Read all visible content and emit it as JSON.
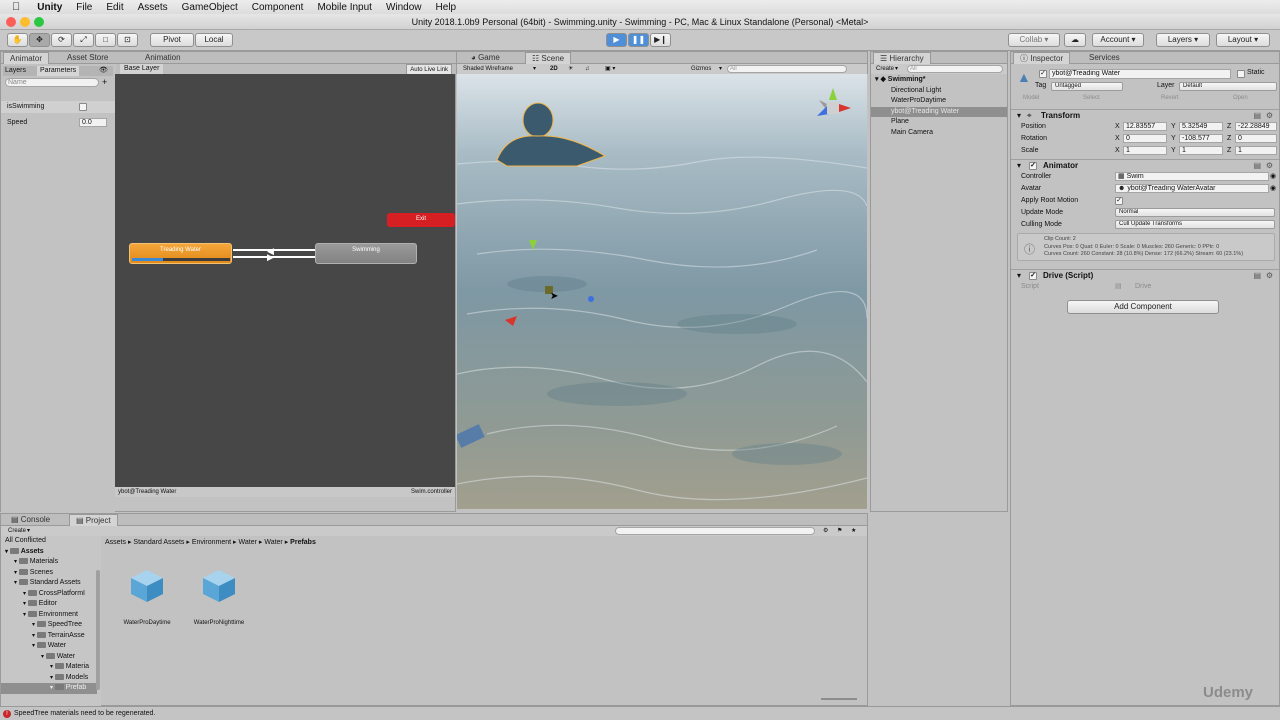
{
  "menubar": {
    "app": "Unity",
    "items": [
      "File",
      "Edit",
      "Assets",
      "GameObject",
      "Component",
      "Mobile Input",
      "Window",
      "Help"
    ]
  },
  "window_title": "Unity 2018.1.0b9 Personal (64bit) - Swimming.unity - Swimming - PC, Mac & Linux Standalone (Personal) <Metal>",
  "toolbar": {
    "pivot": "Pivot",
    "local": "Local",
    "collab": "Collab ▾",
    "account": "Account",
    "layers": "Layers",
    "layout": "Layout"
  },
  "animator": {
    "tabs": [
      "Animator",
      "Asset Store",
      "Animation"
    ],
    "subtabs": [
      "Layers",
      "Parameters"
    ],
    "base_layer": "Base Layer",
    "auto_live_link": "Auto Live Link",
    "search_placeholder": "Name",
    "params": [
      {
        "name": "isSwimming",
        "value": ""
      },
      {
        "name": "Speed",
        "value": "0.0"
      }
    ],
    "nodes": {
      "exit": "Exit",
      "treading": "Treading Water",
      "swimming": "Swimming"
    },
    "footer_left": "ybot@Treading Water",
    "footer_right": "Swim.controller",
    "progress": 0.32
  },
  "scene": {
    "tabs": [
      "Game",
      "Scene"
    ],
    "shading": "Shaded Wireframe",
    "mode_2d": "2D",
    "gizmos": "Gizmos",
    "search_placeholder": "All"
  },
  "hierarchy": {
    "tab": "Hierarchy",
    "create": "Create",
    "search_placeholder": "All",
    "scene": "Swimming*",
    "items": [
      "Directional Light",
      "WaterProDaytime",
      "ybot@Treading Water",
      "Plane",
      "Main Camera"
    ],
    "selected_index": 2
  },
  "inspector": {
    "tabs": [
      "Inspector",
      "Services"
    ],
    "object_name": "ybot@Treading Water",
    "static": "Static",
    "tag_label": "Tag",
    "tag": "Untagged",
    "layer_label": "Layer",
    "layer": "Default",
    "model_buttons": [
      "Model",
      "Select",
      "Revert",
      "Open"
    ],
    "transform": {
      "title": "Transform",
      "position": {
        "label": "Position",
        "x": "12.83557",
        "y": "5.32549",
        "z": "-22.28849"
      },
      "rotation": {
        "label": "Rotation",
        "x": "0",
        "y": "-108.577",
        "z": "0"
      },
      "scale": {
        "label": "Scale",
        "x": "1",
        "y": "1",
        "z": "1"
      }
    },
    "animator": {
      "title": "Animator",
      "controller_label": "Controller",
      "controller": "Swim",
      "avatar_label": "Avatar",
      "avatar": "ybot@Treading WaterAvatar",
      "root_motion_label": "Apply Root Motion",
      "update_label": "Update Mode",
      "update": "Normal",
      "culling_label": "Culling Mode",
      "culling": "Cull Update Transforms",
      "info": [
        "Clip Count: 2",
        "Curves Pos: 0 Quat: 0 Euler: 0 Scale: 0 Muscles: 260 Generic: 0 PPtr: 0",
        "Curves Count: 260 Constant: 28 (10.8%) Dense: 172 (66.2%) Stream: 60 (23.1%)"
      ]
    },
    "drive": {
      "title": "Drive (Script)",
      "script_label": "Script",
      "script": "Drive"
    },
    "add_component": "Add Component"
  },
  "project": {
    "tabs": [
      "Console",
      "Project"
    ],
    "create": "Create",
    "tree": [
      {
        "label": "All Conflicted",
        "indent": 0,
        "folder": false
      },
      {
        "label": "Assets",
        "indent": 0,
        "folder": true,
        "bold": true
      },
      {
        "label": "Materials",
        "indent": 1,
        "folder": true
      },
      {
        "label": "Scenes",
        "indent": 1,
        "folder": true
      },
      {
        "label": "Standard Assets",
        "indent": 1,
        "folder": true
      },
      {
        "label": "CrossPlatformI",
        "indent": 2,
        "folder": true
      },
      {
        "label": "Editor",
        "indent": 2,
        "folder": true
      },
      {
        "label": "Environment",
        "indent": 2,
        "folder": true
      },
      {
        "label": "SpeedTree",
        "indent": 3,
        "folder": true
      },
      {
        "label": "TerrainAsse",
        "indent": 3,
        "folder": true
      },
      {
        "label": "Water",
        "indent": 3,
        "folder": true
      },
      {
        "label": "Water",
        "indent": 4,
        "folder": true
      },
      {
        "label": "Materia",
        "indent": 5,
        "folder": true
      },
      {
        "label": "Models",
        "indent": 5,
        "folder": true
      },
      {
        "label": "Prefab",
        "indent": 5,
        "folder": true,
        "selected": true
      }
    ],
    "breadcrumb": [
      "Assets",
      "Standard Assets",
      "Environment",
      "Water",
      "Water",
      "Prefabs"
    ],
    "assets": [
      "WaterProDaytime",
      "WaterProNighttime"
    ]
  },
  "status": "SpeedTree materials need to be regenerated.",
  "watermark": "Udemy"
}
